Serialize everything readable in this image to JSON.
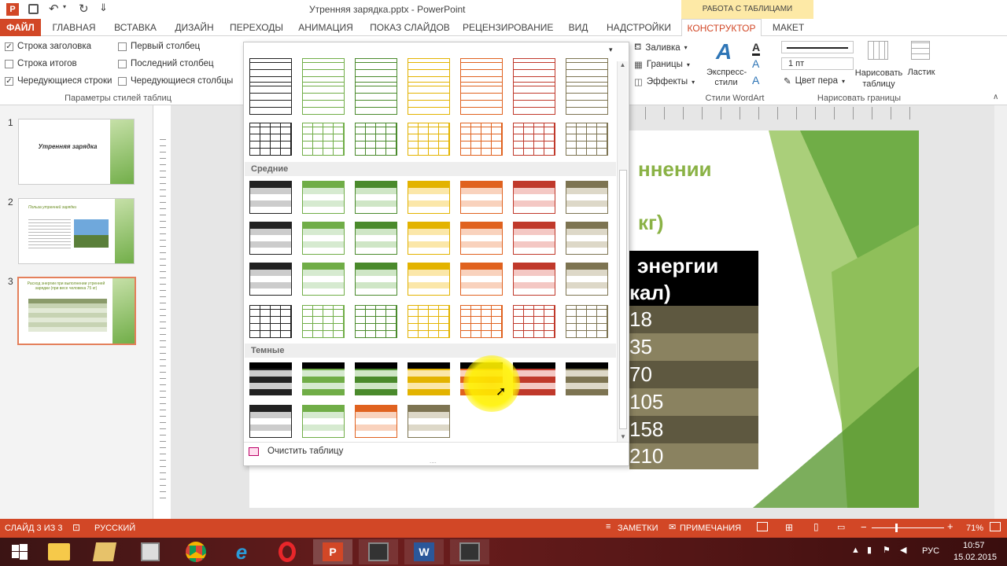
{
  "title": {
    "filename": "Утренняя зарядка.pptx - PowerPoint",
    "context_tab": "РАБОТА С ТАБЛИЦАМИ"
  },
  "tabs": [
    "ФАЙЛ",
    "ГЛАВНАЯ",
    "ВСТАВКА",
    "ДИЗАЙН",
    "ПЕРЕХОДЫ",
    "АНИМАЦИЯ",
    "ПОКАЗ СЛАЙДОВ",
    "РЕЦЕНЗИРОВАНИЕ",
    "ВИД",
    "НАДСТРОЙКИ",
    "КОНСТРУКТОР",
    "МАКЕТ"
  ],
  "options": {
    "header_row": "Строка заголовка",
    "total_row": "Строка итогов",
    "banded_rows": "Чередующиеся строки",
    "first_col": "Первый столбец",
    "last_col": "Последний столбец",
    "banded_cols": "Чередующиеся столбцы",
    "group": "Параметры стилей таблиц"
  },
  "shading": {
    "fill": "Заливка",
    "borders": "Границы",
    "effects": "Эффекты"
  },
  "wordart": {
    "express": "Экспресс-стили",
    "group": "Стили WordArt"
  },
  "draw": {
    "weight": "1 пт",
    "pen_color": "Цвет пера",
    "draw_table": "Нарисовать таблицу",
    "eraser": "Ластик",
    "group": "Нарисовать границы"
  },
  "gallery": {
    "medium": "Средние",
    "dark": "Темные",
    "clear": "Очистить таблицу"
  },
  "slide": {
    "title_part1": "ннении",
    "title_part2": "кг)",
    "header1": "энергии",
    "header2": "кал)",
    "values": [
      "18",
      "35",
      "70",
      "105",
      "158",
      "210"
    ]
  },
  "thumbs": {
    "t1_title": "Утренняя зарядка",
    "t2_title": "Польза утренней зарядки",
    "t3_title": "Расход энергии при выполнении утренней зарядки (при весе человека 75 кг)",
    "numbers": [
      "1",
      "2",
      "3"
    ]
  },
  "status": {
    "slide": "СЛАЙД 3 ИЗ 3",
    "lang": "РУССКИЙ",
    "notes": "ЗАМЕТКИ",
    "comments": "ПРИМЕЧАНИЯ",
    "zoom": "71%"
  },
  "clock": {
    "time": "10:57",
    "date": "15.02.2015",
    "lang": "РУС"
  },
  "colors": {
    "accent": "#d24726",
    "green": "#70ad47",
    "dark_slide_row": "#5e5840",
    "light_slide_row": "#8a8260"
  }
}
